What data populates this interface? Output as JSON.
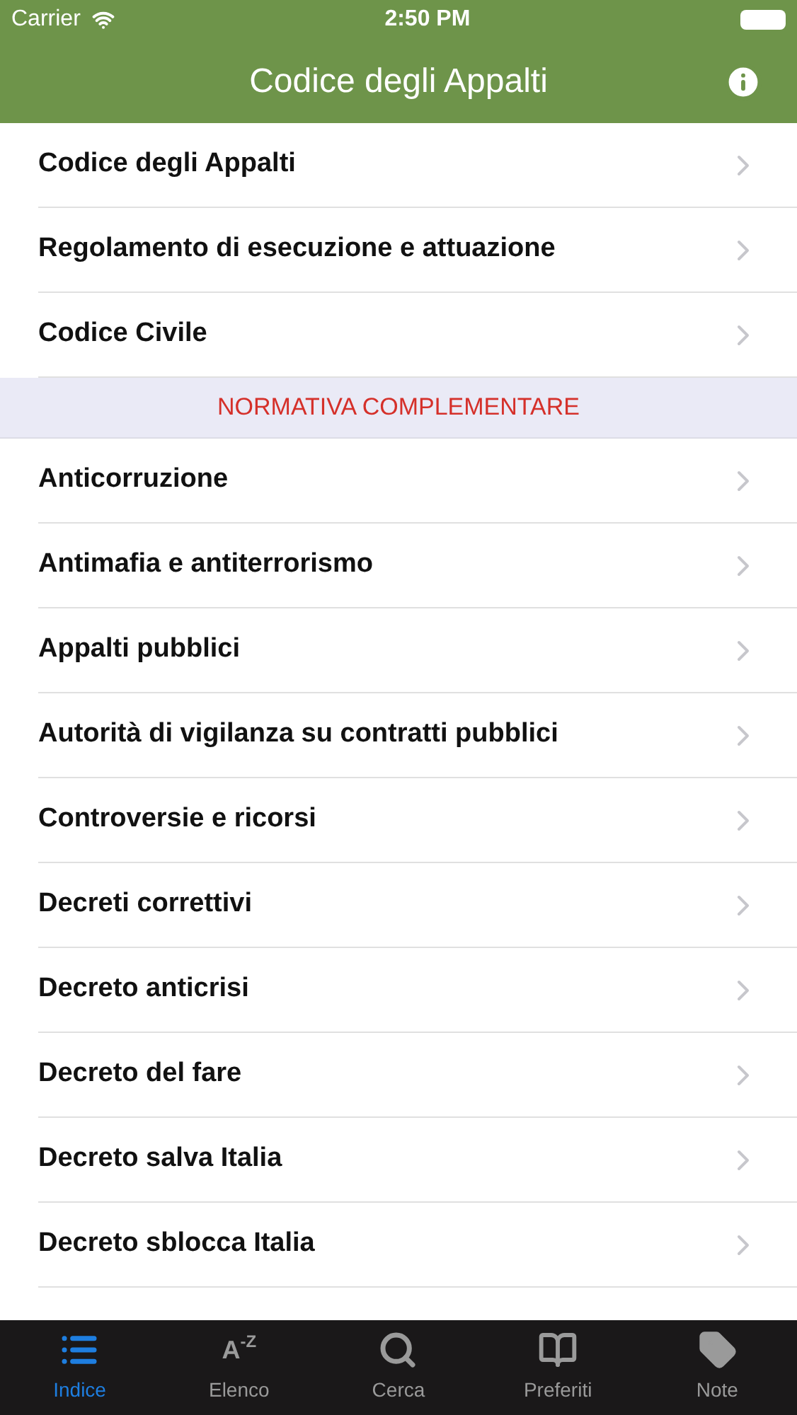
{
  "status_bar": {
    "carrier": "Carrier",
    "time": "2:50 PM"
  },
  "nav": {
    "title": "Codice degli Appalti"
  },
  "sections": [
    {
      "items": [
        "Codice degli Appalti",
        "Regolamento di esecuzione e attuazione",
        "Codice Civile"
      ]
    },
    {
      "header": "NORMATIVA COMPLEMENTARE",
      "items": [
        "Anticorruzione",
        "Antimafia e antiterrorismo",
        "Appalti pubblici",
        "Autorità di vigilanza su contratti pubblici",
        "Controversie e ricorsi",
        "Decreti correttivi",
        "Decreto anticrisi",
        "Decreto del fare",
        "Decreto salva Italia",
        "Decreto sblocca Italia"
      ]
    }
  ],
  "tabs": [
    {
      "kind": "list",
      "label": "Indice",
      "selected": true
    },
    {
      "kind": "az",
      "label": "Elenco",
      "selected": false,
      "glyph_a": "A",
      "glyph_z": "-Z"
    },
    {
      "kind": "search",
      "label": "Cerca",
      "selected": false
    },
    {
      "kind": "book",
      "label": "Preferiti",
      "selected": false
    },
    {
      "kind": "tag",
      "label": "Note",
      "selected": false
    }
  ]
}
